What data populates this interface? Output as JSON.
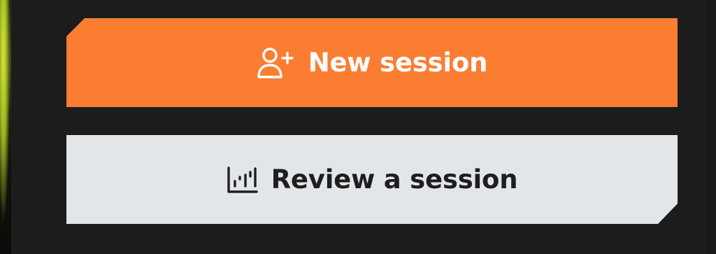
{
  "actions": {
    "new_session": {
      "label": "New session",
      "icon": "user-plus-icon",
      "background": "#fb7d32",
      "text_color": "#ffffff"
    },
    "review_session": {
      "label": "Review a session",
      "icon": "bar-chart-icon",
      "background": "#e3e6e9",
      "text_color": "#1e1e1e"
    }
  },
  "theme": {
    "page_background": "#1c1c1c"
  }
}
